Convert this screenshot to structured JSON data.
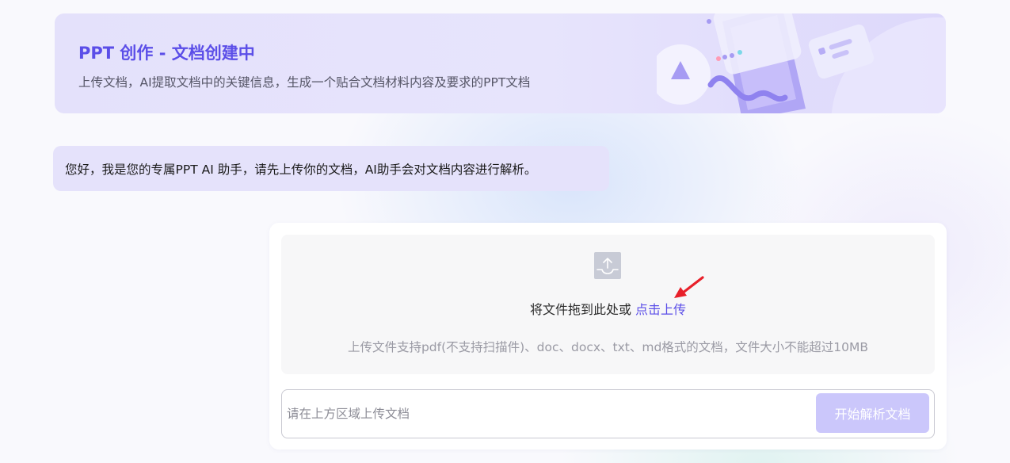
{
  "banner": {
    "title": "PPT 创作 - 文档创建中",
    "subtitle": "上传文档，AI提取文档中的关键信息，生成一个贴合文档材料内容及要求的PPT文档"
  },
  "chat": {
    "assistant_message": "您好，我是您的专属PPT AI 助手，请先上传你的文档，AI助手会对文档内容进行解析。"
  },
  "upload": {
    "icon": "upload-icon",
    "drop_text": "将文件拖到此处或 ",
    "drop_link": "点击上传",
    "hint": "上传文件支持pdf(不支持扫描件)、doc、docx、txt、md格式的文档，文件大小不能超过10MB"
  },
  "input": {
    "placeholder": "请在上方区域上传文档",
    "value": ""
  },
  "actions": {
    "parse_label": "开始解析文档"
  },
  "colors": {
    "accent": "#5b4ee8",
    "banner_bg": "#e4e1fb",
    "bubble_bg": "#e5e2fb",
    "button_disabled": "#cbc7fb",
    "annotation_arrow": "#e8202a"
  }
}
